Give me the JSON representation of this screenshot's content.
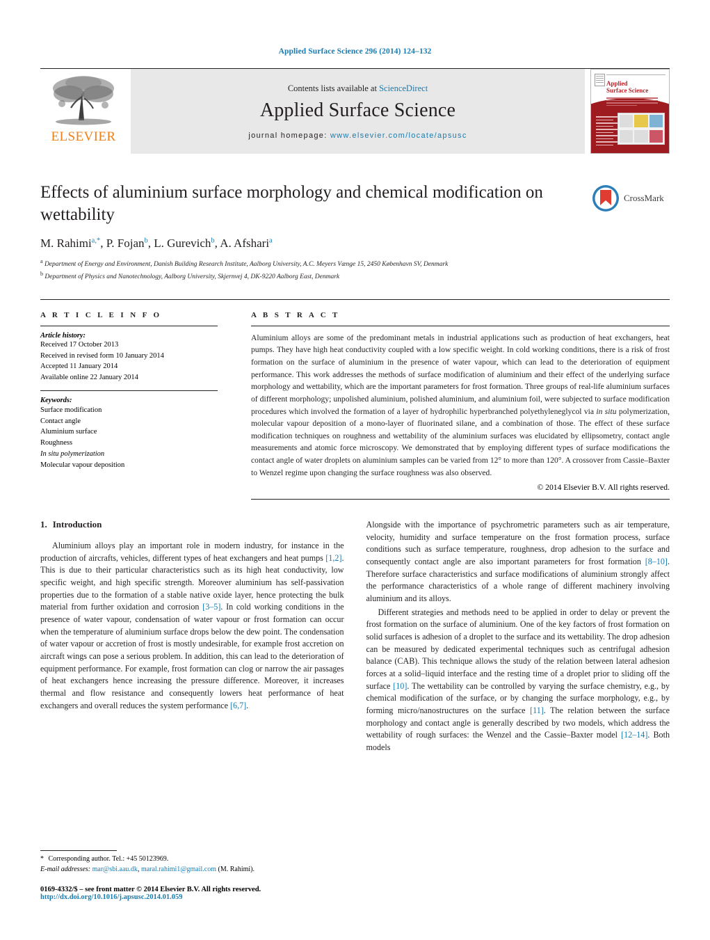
{
  "running_head": "Applied Surface Science 296 (2014) 124–132",
  "masthead": {
    "contents_prefix": "Contents lists available at ",
    "sciencedirect": "ScienceDirect",
    "journal_name": "Applied Surface Science",
    "homepage_label": "journal homepage:",
    "homepage_url": "www.elsevier.com/locate/apsusc",
    "publisher": "ELSEVIER",
    "cover_title_line1": "Applied",
    "cover_title_line2": "Surface Science"
  },
  "article": {
    "title": "Effects of aluminium surface morphology and chemical modification on wettability",
    "authors_html": "M. Rahimi<sup>a,*</sup>, P. Fojan<sup>b</sup>, L. Gurevich<sup>b</sup>, A. Afshari<sup>a</sup>",
    "affiliation_a": "Department of Energy and Environment, Danish Building Research Institute, Aalborg University, A.C. Meyers Vænge 15, 2450 København SV, Denmark",
    "affiliation_b": "Department of Physics and Nanotechnology, Aalborg University, Skjernvej 4, DK-9220 Aalborg East, Denmark",
    "crossmark_label": "CrossMark"
  },
  "article_info": {
    "heading": "A R T I C L E   I N F O",
    "history_label": "Article history:",
    "history": [
      "Received 17 October 2013",
      "Received in revised form 10 January 2014",
      "Accepted 11 January 2014",
      "Available online 22 January 2014"
    ],
    "keywords_label": "Keywords:",
    "keywords": [
      "Surface modification",
      "Contact angle",
      "Aluminium surface",
      "Roughness",
      "In situ polymerization",
      "Molecular vapour deposition"
    ]
  },
  "abstract": {
    "heading": "A B S T R A C T",
    "text_html": "Aluminium alloys are some of the predominant metals in industrial applications such as production of heat exchangers, heat pumps. They have high heat conductivity coupled with a low specific weight. In cold working conditions, there is a risk of frost formation on the surface of aluminium in the presence of water vapour, which can lead to the deterioration of equipment performance. This work addresses the methods of surface modification of aluminium and their effect of the underlying surface morphology and wettability, which are the important parameters for frost formation. Three groups of real-life aluminium surfaces of different morphology; unpolished aluminium, polished aluminium, and aluminium foil, were subjected to surface modification procedures which involved the formation of a layer of hydrophilic hyperbranched polyethyleneglycol via <i>in situ</i> polymerization, molecular vapour deposition of a mono-layer of fluorinated silane, and a combination of those. The effect of these surface modification techniques on roughness and wettability of the aluminium surfaces was elucidated by ellipsometry, contact angle measurements and atomic force microscopy. We demonstrated that by employing different types of surface modifications the contact angle of water droplets on aluminium samples can be varied from 12° to more than 120°. A crossover from Cassie–Baxter to Wenzel regime upon changing the surface roughness was also observed.",
    "copyright": "© 2014 Elsevier B.V. All rights reserved."
  },
  "introduction": {
    "number": "1.",
    "title": "Introduction",
    "left_paragraphs_html": [
      "Aluminium alloys play an important role in modern industry, for instance in the production of aircrafts, vehicles, different types of heat exchangers and heat pumps <span class=\"cite\">[1,2]</span>. This is due to their particular characteristics such as its high heat conductivity, low specific weight, and high specific strength. Moreover aluminium has self-passivation properties due to the formation of a stable native oxide layer, hence protecting the bulk material from further oxidation and corrosion <span class=\"cite\">[3–5]</span>. In cold working conditions in the presence of water vapour, condensation of water vapour or frost formation can occur when the temperature of aluminium surface drops below the dew point. The condensation of water vapour or accretion of frost is mostly undesirable, for example frost accretion on aircraft wings can pose a serious problem. In addition, this can lead to the deterioration of equipment performance. For example, frost formation can clog or narrow the air passages of heat exchangers hence increasing the pressure difference. Moreover, it increases thermal and flow resistance and consequently lowers heat performance of heat exchangers and overall reduces the system performance <span class=\"cite\">[6,7]</span>."
    ],
    "right_paragraphs_html": [
      "Alongside with the importance of psychrometric parameters such as air temperature, velocity, humidity and surface temperature on the frost formation process, surface conditions such as surface temperature, roughness, drop adhesion to the surface and consequently contact angle are also important parameters for frost formation <span class=\"cite\">[8–10]</span>. Therefore surface characteristics and surface modifications of aluminium strongly affect the performance characteristics of a whole range of different machinery involving aluminium and its alloys.",
      "Different strategies and methods need to be applied in order to delay or prevent the frost formation on the surface of aluminium. One of the key factors of frost formation on solid surfaces is adhesion of a droplet to the surface and its wettability. The drop adhesion can be measured by dedicated experimental techniques such as centrifugal adhesion balance (CAB). This technique allows the study of the relation between lateral adhesion forces at a solid–liquid interface and the resting time of a droplet prior to sliding off the surface <span class=\"cite\">[10]</span>. The wettability can be controlled by varying the surface chemistry, e.g., by chemical modification of the surface, or by changing the surface morphology, e.g., by forming micro/nanostructures on the surface <span class=\"cite\">[11]</span>. The relation between the surface morphology and contact angle is generally described by two models, which address the wettability of rough surfaces: the Wenzel and the Cassie–Baxter model <span class=\"cite\">[12–14]</span>. Both models"
    ]
  },
  "footnotes": {
    "corresponding_html": "<span class=\"star\">*</span> Corresponding author. Tel.: +45 50123969.",
    "email_label": "E-mail addresses:",
    "email_1": "mar@sbi.aau.dk",
    "email_2": "maral.rahimi1@gmail.com",
    "email_suffix": "(M. Rahimi).",
    "issn_line": "0169-4332/$ – see front matter © 2014 Elsevier B.V. All rights reserved.",
    "doi_line": "http://dx.doi.org/10.1016/j.apsusc.2014.01.059"
  },
  "colors": {
    "link_blue": "#1a7bb0",
    "elsevier_orange": "#f07f13",
    "cover_red": "#9e1b20",
    "masthead_grey": "#e8e8e8"
  }
}
